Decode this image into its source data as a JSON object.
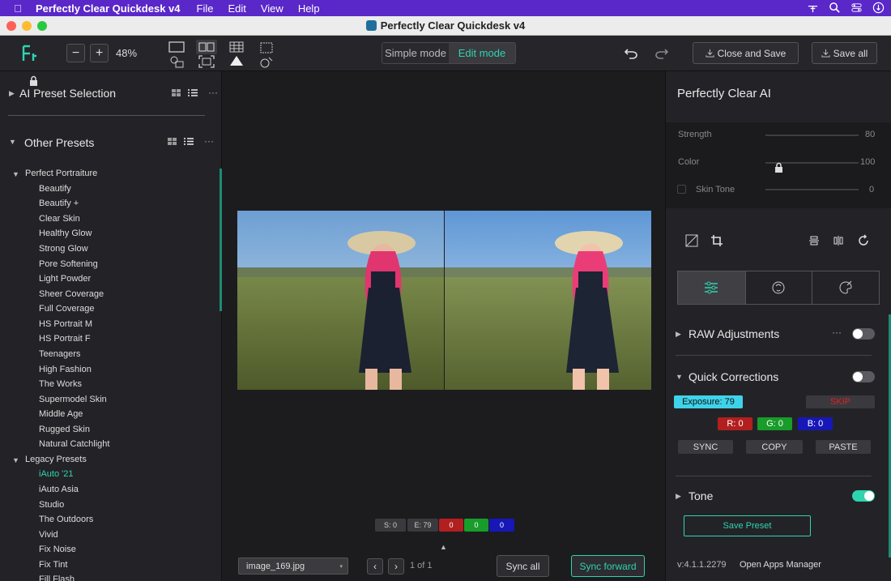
{
  "menubar": {
    "app": "Perfectly Clear Quickdesk v4",
    "items": [
      "File",
      "Edit",
      "View",
      "Help"
    ]
  },
  "window": {
    "title": "Perfectly Clear Quickdesk v4"
  },
  "toolbar": {
    "zoom": "48%",
    "simple_mode": "Simple mode",
    "edit_mode": "Edit mode",
    "close_save": "Close and Save",
    "save_all": "Save all"
  },
  "left": {
    "ai_preset": "AI Preset Selection",
    "other_presets": "Other Presets",
    "groups": [
      {
        "name": "Perfect Portraiture",
        "items": [
          "Beautify",
          "Beautify +",
          "Clear Skin",
          "Healthy Glow",
          "Strong Glow",
          "Pore Softening",
          "Light Powder",
          "Sheer Coverage",
          "Full Coverage",
          "HS Portrait M",
          "HS Portrait F",
          "Teenagers",
          "High Fashion",
          "The Works",
          "Supermodel Skin",
          "Middle Age",
          "Rugged Skin",
          "Natural Catchlight"
        ]
      },
      {
        "name": "Legacy Presets",
        "items": [
          "iAuto '21",
          "iAuto Asia",
          "Studio",
          "The Outdoors",
          "Vivid",
          "Fix Noise",
          "Fix Tint",
          "Fill Flash"
        ]
      }
    ]
  },
  "center": {
    "stats": {
      "s": "S: 0",
      "e": "E: 79",
      "r": "0",
      "g": "0",
      "b": "0"
    },
    "file": "image_169.jpg",
    "page": "1 of 1",
    "sync_all": "Sync all",
    "sync_forward": "Sync forward"
  },
  "right": {
    "title": "Perfectly Clear AI",
    "strength_label": "Strength",
    "strength_val": "80",
    "color_label": "Color",
    "color_val": "100",
    "skin_label": "Skin Tone",
    "skin_val": "0",
    "raw": "RAW Adjustments",
    "quick": "Quick Corrections",
    "exposure": "Exposure: 79",
    "skip": "SKIP",
    "r": "R: 0",
    "g": "G: 0",
    "b": "B: 0",
    "sync": "SYNC",
    "copy": "COPY",
    "paste": "PASTE",
    "tone": "Tone",
    "save_preset": "Save Preset",
    "version": "v:4.1.1.2279",
    "open_apps": "Open Apps Manager"
  },
  "colors": {
    "accent": "#2fd3b0",
    "menubar": "#5a27c9"
  }
}
